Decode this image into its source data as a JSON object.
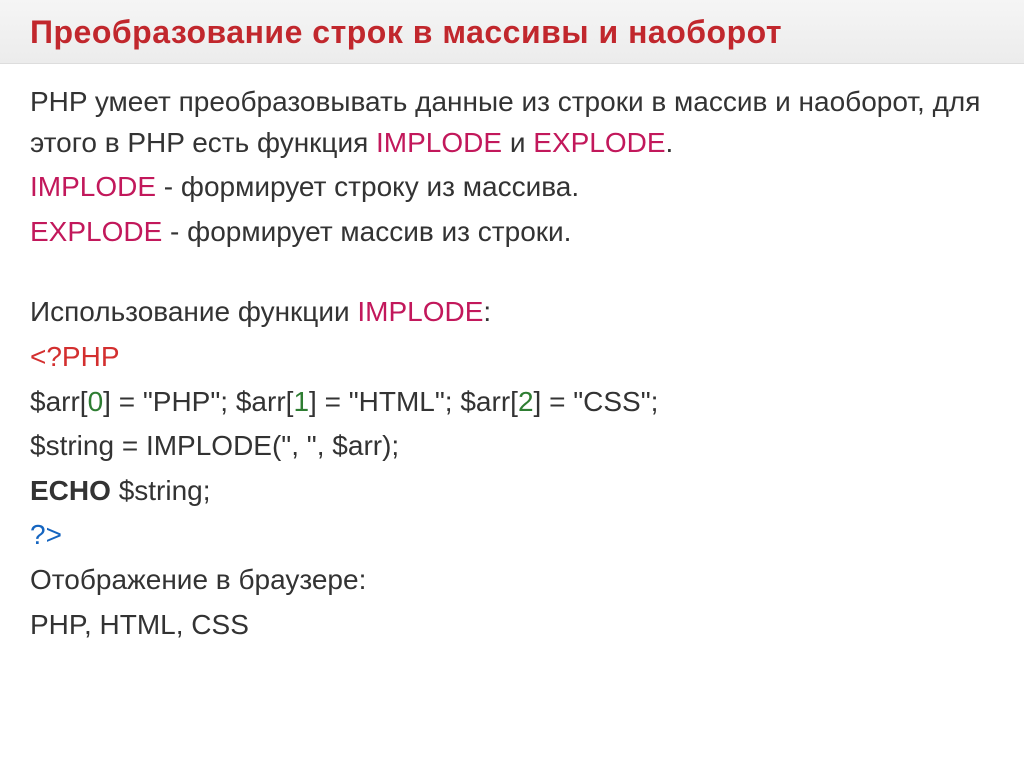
{
  "title": "Преобразование строк в массивы и наоборот",
  "intro": {
    "p1a": "PHP умеет преобразовывать данные из строки в массив и наоборот, для этого в PHP есть функция ",
    "implode": "IMPLODE",
    "p1b": " и ",
    "explode": "EXPLODE",
    "p1c": "."
  },
  "desc1": {
    "implode": "IMPLODE",
    "text": " - формирует строку из массива."
  },
  "desc2": {
    "explode": "EXPLODE",
    "text": " - формирует массив из строки."
  },
  "usage": {
    "text": "Использование функции ",
    "implode": "IMPLODE",
    "colon": ":"
  },
  "code": {
    "open": "<?PHP",
    "line1": {
      "a": "$arr[",
      "n0": "0",
      "b": "] = \"PHP\"; $arr[",
      "n1": "1",
      "c": "] = \"HTML\"; $arr[",
      "n2": "2",
      "d": "] = \"CSS\";"
    },
    "line2": "$string = IMPLODE(\", \", $arr);",
    "line3a": "ECHO ",
    "line3b": "$string;",
    "close": "?>"
  },
  "browser": {
    "label": "Отображение в браузере:",
    "output": "PHP,  HTML,  CSS"
  }
}
